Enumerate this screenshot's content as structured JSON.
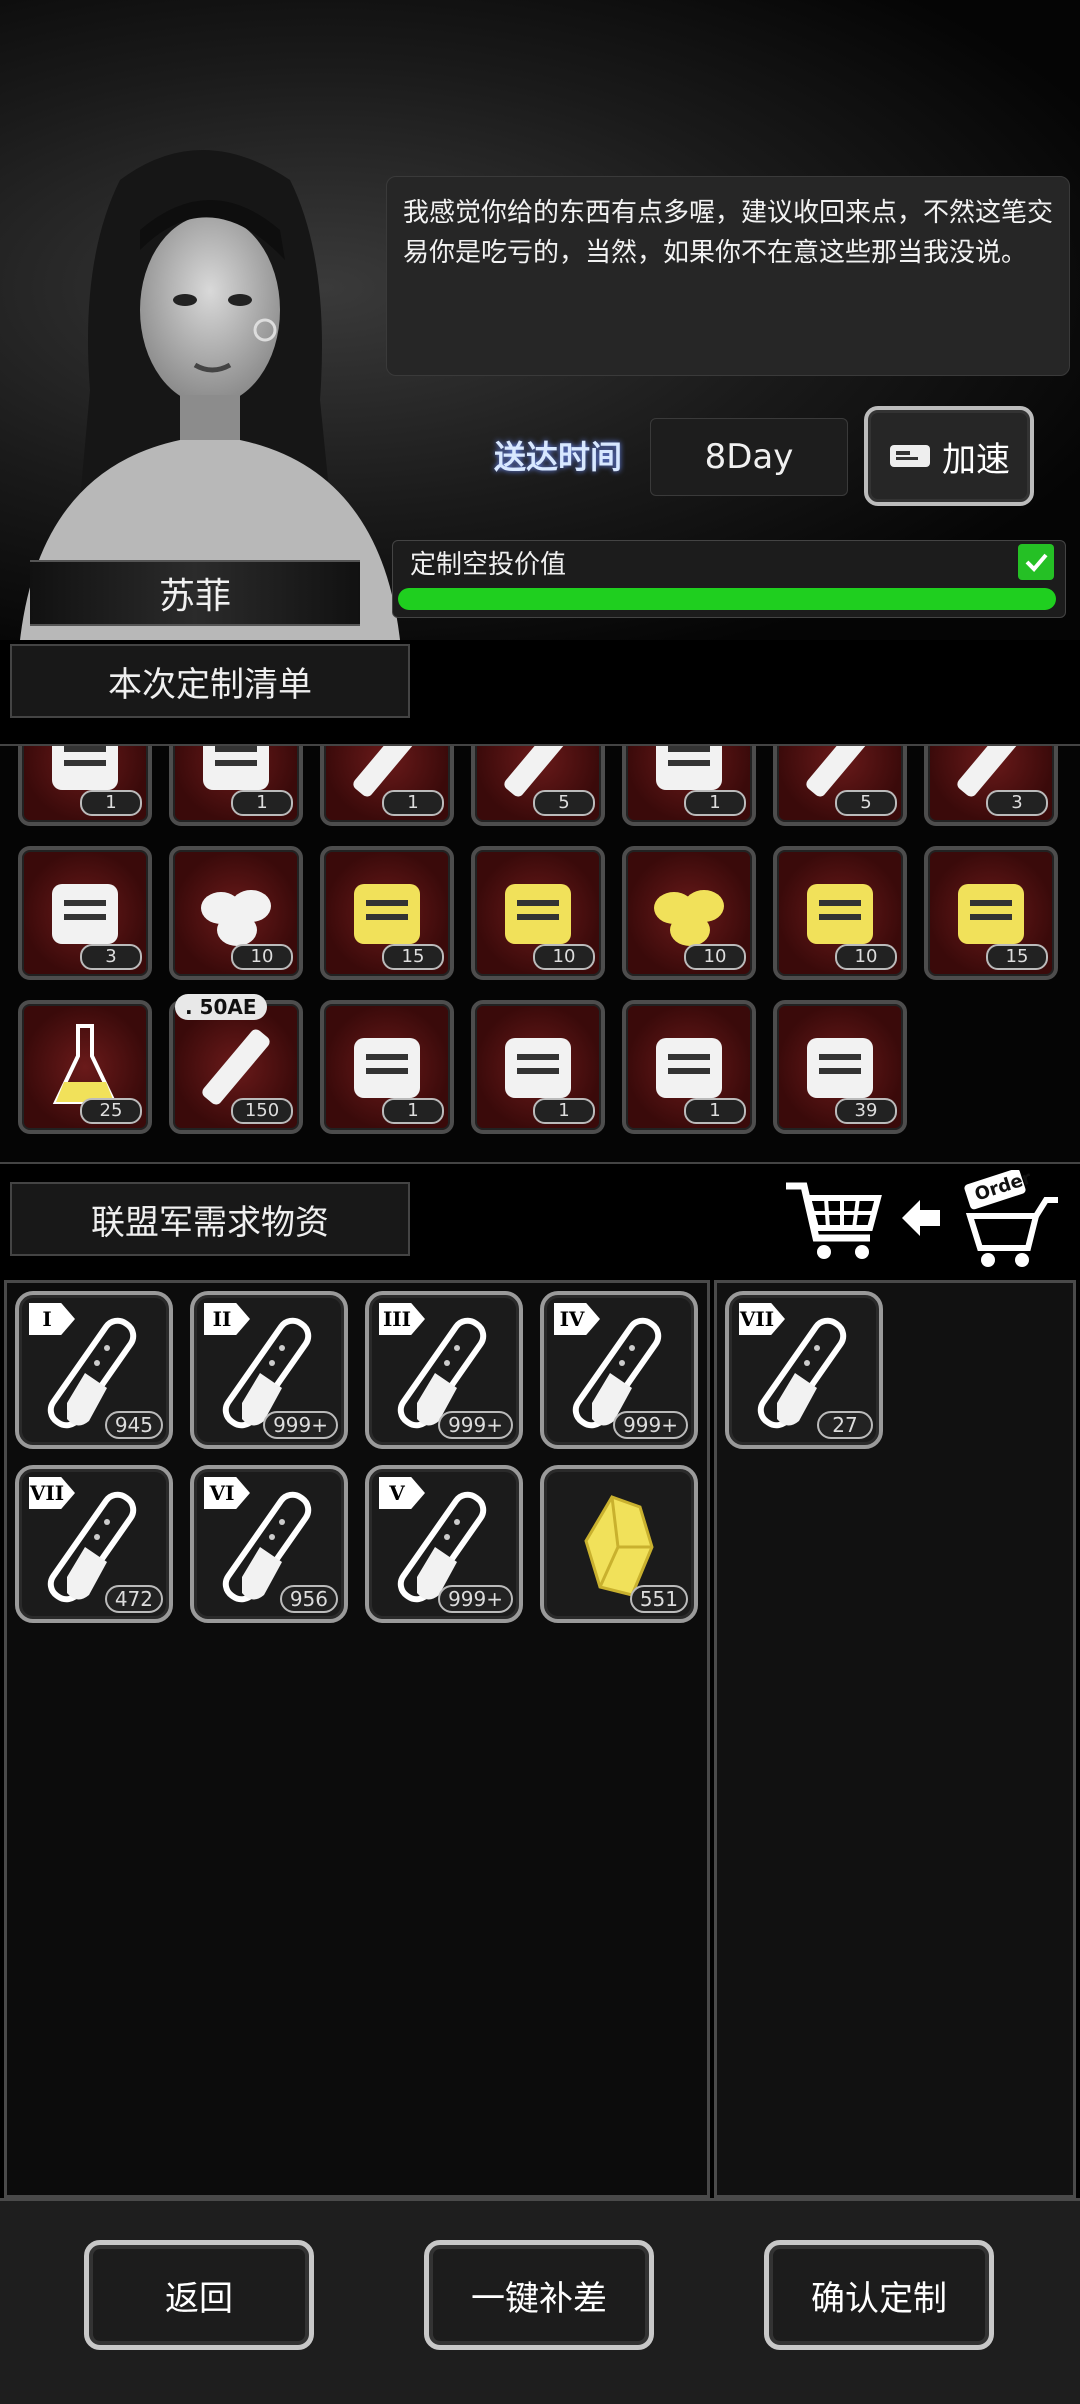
{
  "npc": {
    "name": "苏菲",
    "dialog": "我感觉你给的东西有点多喔，建议收回来点，不然这笔交易你是吃亏的，当然，如果你不在意这些那当我没说。"
  },
  "delivery": {
    "label": "送达时间",
    "value": "8Day",
    "speed_label": "加速"
  },
  "value_bar": {
    "label": "定制空投价值",
    "fill_fraction": 1.0,
    "checked": true,
    "color": "#1fcf1f"
  },
  "order_list": {
    "title": "本次定制清单",
    "items": [
      {
        "icon": "medical-kit-partial-icon",
        "count": "1"
      },
      {
        "icon": "first-aid-box-icon",
        "count": "1"
      },
      {
        "icon": "syringe-plus-icon",
        "count": "1"
      },
      {
        "icon": "syringe-icon",
        "count": "5"
      },
      {
        "icon": "ampoules-icon",
        "count": "1"
      },
      {
        "icon": "injector-pen-icon",
        "count": "5"
      },
      {
        "icon": "cigarette-icon",
        "count": "3"
      },
      {
        "icon": "canned-food-icon",
        "count": "3"
      },
      {
        "icon": "seeds-icon",
        "count": "10"
      },
      {
        "icon": "bullets-yellow-icon",
        "count": "15"
      },
      {
        "icon": "parts-pile-icon",
        "count": "10"
      },
      {
        "icon": "nuggets-icon",
        "count": "10"
      },
      {
        "icon": "fuel-canister-icon",
        "count": "10"
      },
      {
        "icon": "gold-fabric-icon",
        "count": "15"
      },
      {
        "icon": "chemical-flask-icon",
        "count": "25"
      },
      {
        "icon": "ammo-50ae-icon",
        "count": "150",
        "tag": ". 50AE"
      },
      {
        "icon": "body-armor-icon",
        "count": "1"
      },
      {
        "icon": "arm-guard-icon",
        "count": "1"
      },
      {
        "icon": "gauntlets-icon",
        "count": "1"
      },
      {
        "icon": "cloth-roll-icon",
        "count": "39"
      }
    ]
  },
  "demand": {
    "title": "联盟军需求物资",
    "cart_icon": "cart-icon",
    "arrow_icon": "arrow-left-icon",
    "order_icon": "order-cart-icon",
    "order_text": "Order",
    "left_items": [
      {
        "label": "I",
        "count": "945",
        "icon": "test-tube-icon"
      },
      {
        "label": "II",
        "count": "999+",
        "icon": "test-tube-icon"
      },
      {
        "label": "III",
        "count": "999+",
        "icon": "test-tube-icon"
      },
      {
        "label": "IV",
        "count": "999+",
        "icon": "test-tube-icon"
      },
      {
        "label": "VII",
        "count": "472",
        "icon": "test-tube-icon"
      },
      {
        "label": "VI",
        "count": "956",
        "icon": "test-tube-icon"
      },
      {
        "label": "V",
        "count": "999+",
        "icon": "test-tube-icon"
      },
      {
        "label": "",
        "count": "551",
        "icon": "gold-crystal-icon"
      }
    ],
    "right_items": [
      {
        "label": "VII",
        "count": "27",
        "icon": "test-tube-icon"
      }
    ]
  },
  "actions": {
    "back": "返回",
    "fill": "一键补差",
    "confirm": "确认定制"
  }
}
